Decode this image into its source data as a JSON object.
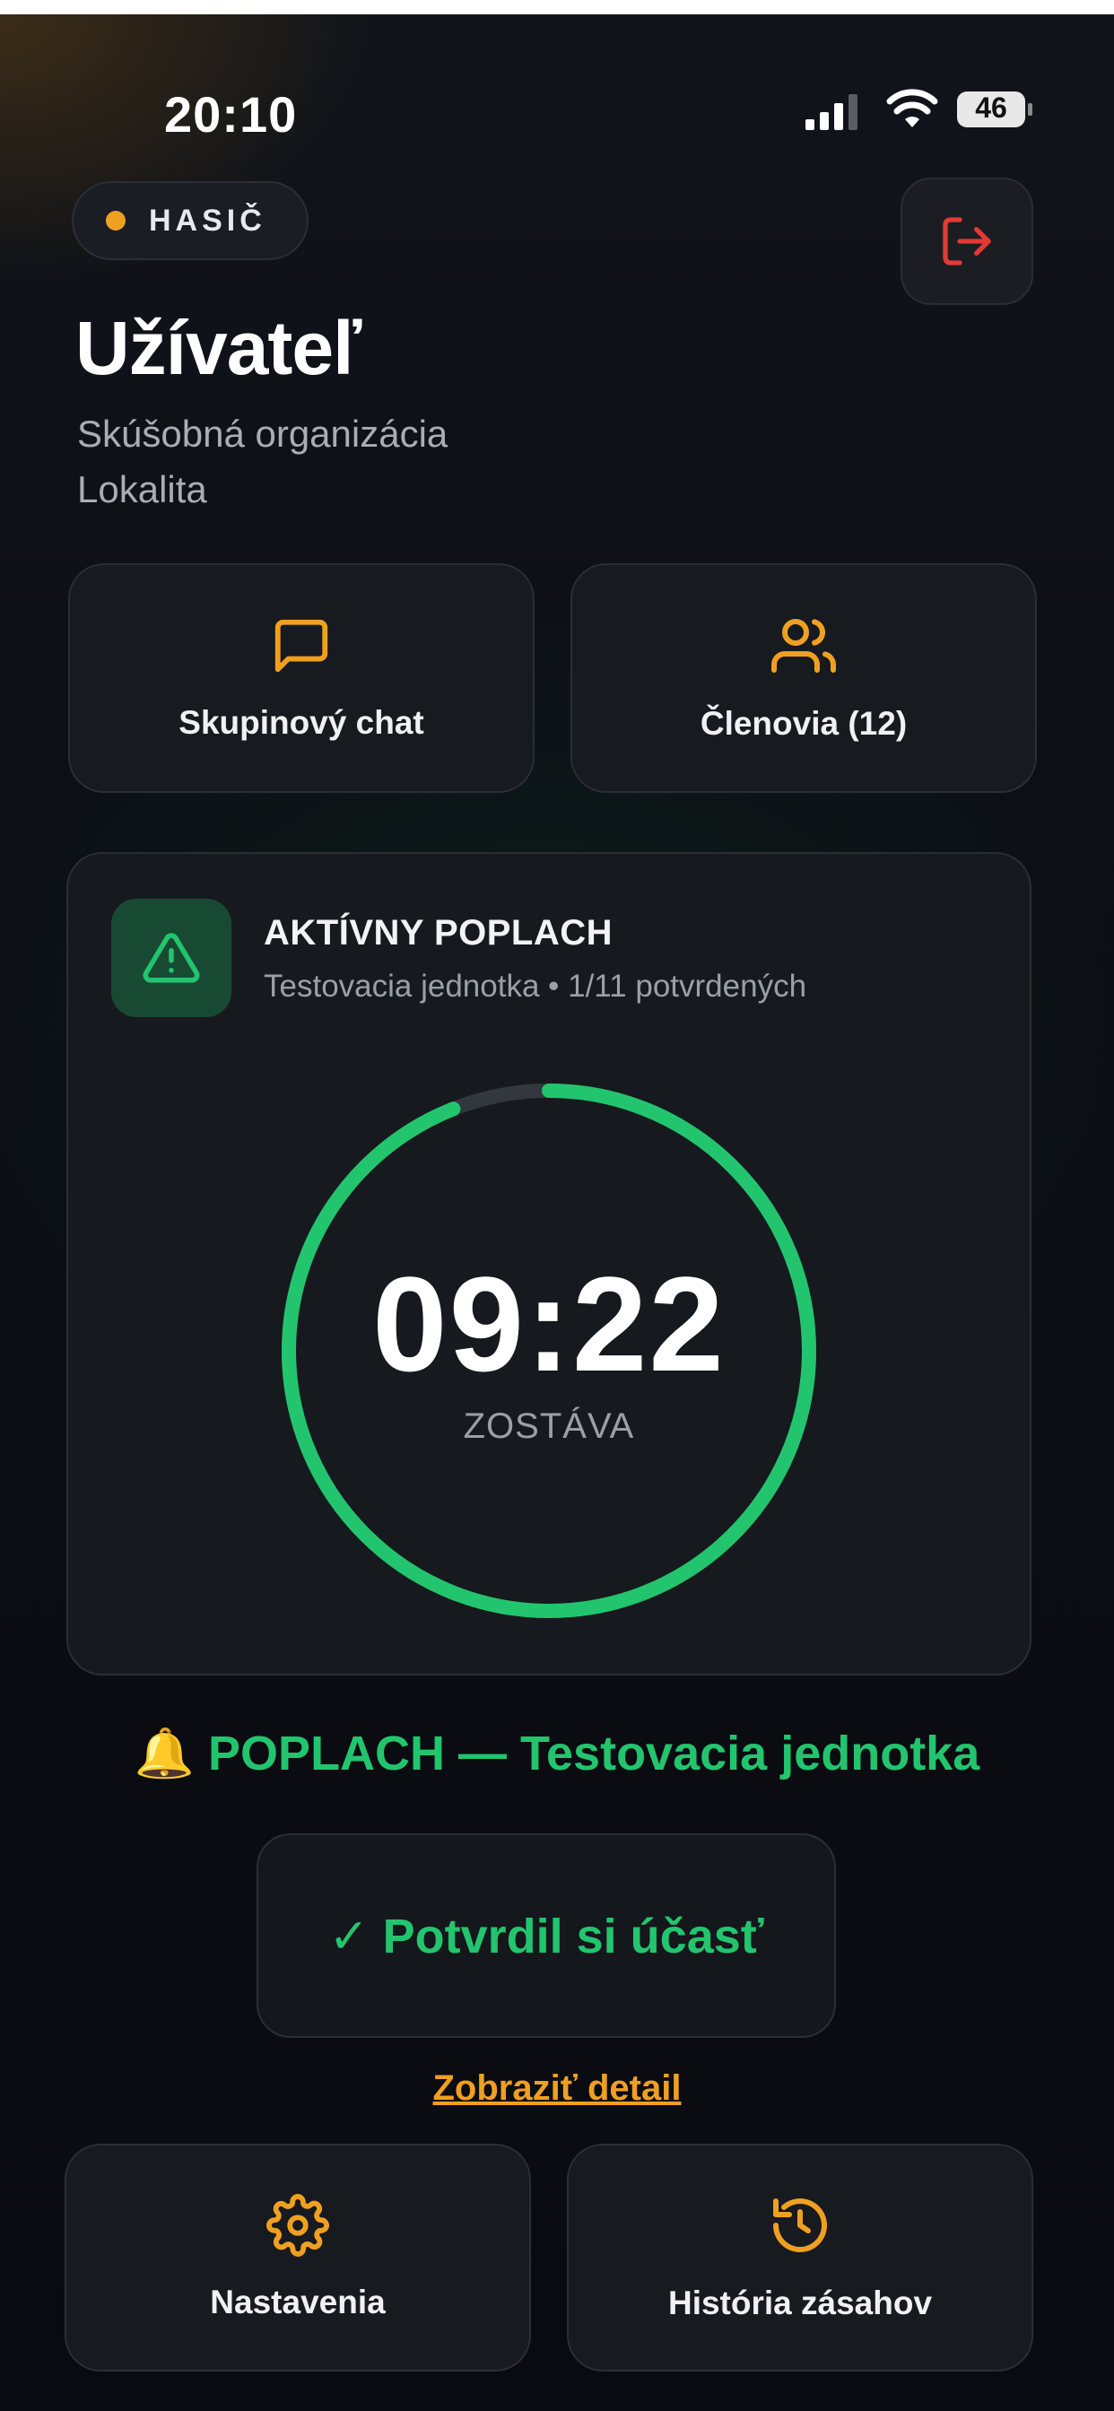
{
  "status_bar": {
    "time": "20:10",
    "battery": "46"
  },
  "header": {
    "role": "HASIČ",
    "user_name": "Užívateľ",
    "organization": "Skúšobná organizácia",
    "location": "Lokalita"
  },
  "quick_actions": {
    "chat_label": "Skupinový chat",
    "members_label": "Členovia (12)"
  },
  "alarm_card": {
    "title": "AKTÍVNY POPLACH",
    "subtitle": "Testovacia jednotka • 1/11 potvrdených",
    "countdown": "09:22",
    "remaining_label": "ZOSTÁVA",
    "progress_fraction": 0.94
  },
  "banner": {
    "bell": "🔔",
    "text": "POPLACH — Testovacia jednotka"
  },
  "confirm": {
    "label": "✓ Potvrdil si účasť"
  },
  "detail_link": "Zobraziť detail",
  "bottom_actions": {
    "settings_label": "Nastavenia",
    "history_label": "História zásahov"
  },
  "colors": {
    "accent_orange": "#f0a020",
    "success_green": "#22c56e",
    "danger_red": "#e53935"
  },
  "icons": [
    "signal-icon",
    "wifi-icon",
    "battery-icon",
    "logout-icon",
    "chat-icon",
    "users-icon",
    "warning-icon",
    "bell-icon",
    "settings-icon",
    "history-icon"
  ]
}
